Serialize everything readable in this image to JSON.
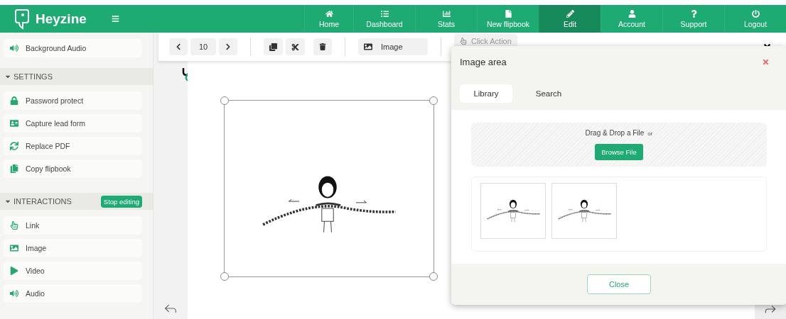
{
  "brand": "Heyzine",
  "nav": [
    {
      "label": "Home",
      "selected": false
    },
    {
      "label": "Dashboard",
      "selected": false
    },
    {
      "label": "Stats",
      "selected": false
    },
    {
      "label": "New flipbook",
      "selected": false
    },
    {
      "label": "Edit",
      "selected": true
    },
    {
      "label": "Account",
      "selected": false
    },
    {
      "label": "Support",
      "selected": false
    },
    {
      "label": "Logout",
      "selected": false
    }
  ],
  "sidebar": {
    "top_items": [
      {
        "label": "Background Audio"
      }
    ],
    "sections": [
      {
        "title": "SETTINGS",
        "expanded": true,
        "items": [
          {
            "label": "Password protect"
          },
          {
            "label": "Capture lead form"
          },
          {
            "label": "Replace PDF"
          },
          {
            "label": "Copy flipbook"
          }
        ]
      },
      {
        "title": "INTERACTIONS",
        "expanded": true,
        "badge": "Stop editing",
        "items": [
          {
            "label": "Link"
          },
          {
            "label": "Image"
          },
          {
            "label": "Video"
          },
          {
            "label": "Audio"
          }
        ]
      }
    ]
  },
  "toolbar": {
    "page": "10",
    "element_type": "Image",
    "action": "Click Action"
  },
  "modal": {
    "title": "Image area",
    "tabs": [
      {
        "label": "Library",
        "selected": true
      },
      {
        "label": "Search",
        "selected": false
      }
    ],
    "dropzone": {
      "text": "Drag & Drop a File",
      "or": "or",
      "button": "Browse File"
    },
    "thumbnails": [
      {
        "kind": "drawing"
      },
      {
        "kind": "drawing"
      }
    ],
    "close_button": "Close"
  }
}
